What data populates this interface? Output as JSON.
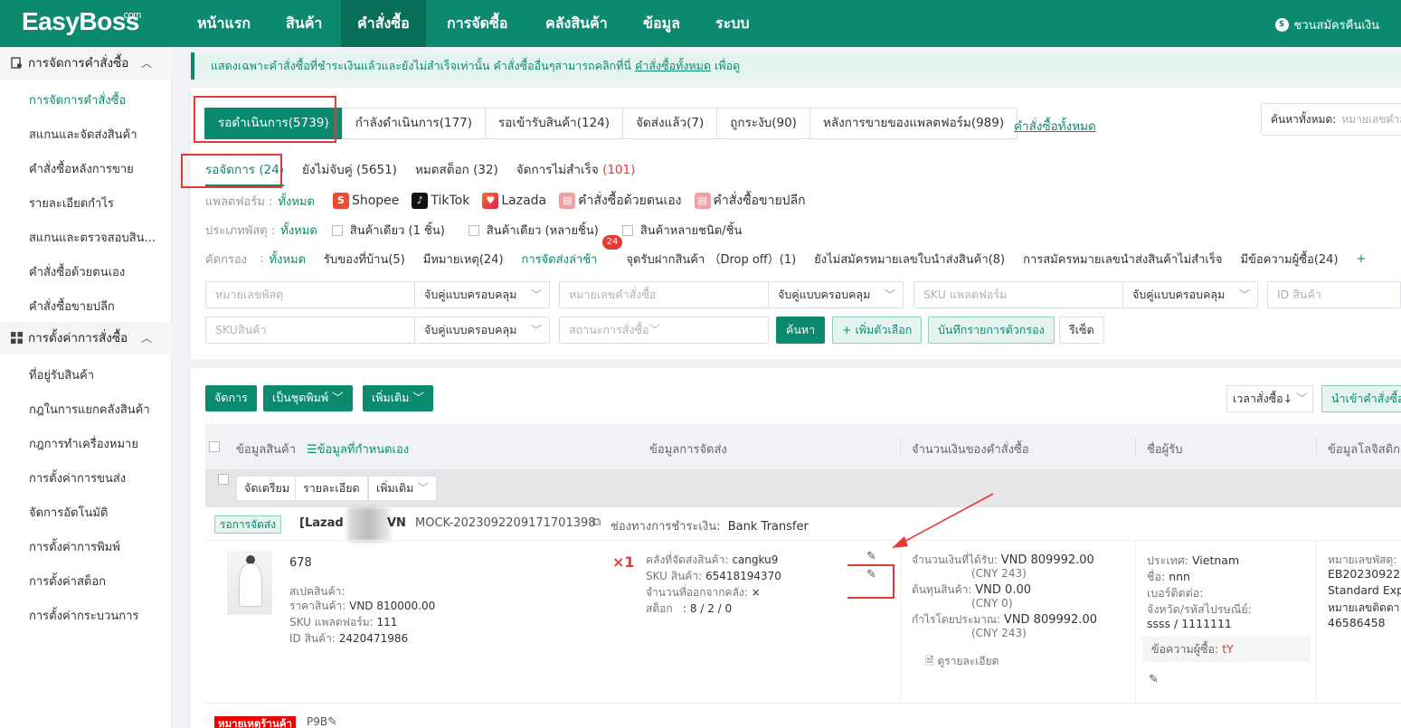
{
  "app": {
    "logo": "EasyBoss",
    "logo_sup": ".com"
  },
  "topnav": {
    "items": [
      "หน้าแรก",
      "สินค้า",
      "คำสั่งซื้อ",
      "การจัดซื้อ",
      "คลังสินค้า",
      "ข้อมูล",
      "ระบบ"
    ],
    "active_index": 2,
    "right_text": "ชวนสมัครคืนเงิน"
  },
  "sidebar": {
    "group1": "การจัดการคำสั่งซื้อ",
    "group1_items": [
      "การจัดการคำสั่งซื้อ",
      "สแกนและจัดส่งสินค้า",
      "คำสั่งซื้อหลังการขาย",
      "รายละเอียดกำไร",
      "สแกนและตรวจสอบสิน...",
      "คำสั่งซื้อด้วยตนเอง",
      "คำสั่งซื้อขายปลีก"
    ],
    "group2": "การตั้งค่าการสั่งซื้อ",
    "group2_items": [
      "ที่อยู่รับสินค้า",
      "กฎในการแยกคลังสินค้า",
      "กฎการทำเครื่องหมาย",
      "การตั้งค่าการขนส่ง",
      "จัดการอัตโนมัติ",
      "การตั้งค่าการพิมพ์",
      "การตั้งค่าสต็อก",
      "การตั้งค่ากระบวนการ"
    ]
  },
  "notice": {
    "text": "แสดงเฉพาะคำสั่งซื้อที่ชำระเงินแล้วและยังไม่สำเร็จเท่านั้น คำสั่งซื้ออื่นๆสามารถคลิกที่นี่",
    "link": "คำสั่งซื้อทั้งหมด",
    "suffix": "เพื่อดู"
  },
  "tabs": {
    "items": [
      "รอดำเนินการ(5739)",
      "กำลังดำเนินการ(177)",
      "รอเข้ารับสินค้า(124)",
      "จัดส่งแล้ว(7)",
      "ถูกระงับ(90)",
      "หลังการขายของแพลตฟอร์ม(989)"
    ],
    "all_link": "คำสั่งซื้อทั้งหมด"
  },
  "search": {
    "label": "ค้นหาทั้งหมด:",
    "placeholder": "หมายเลขคำสั่งซื้อ"
  },
  "subtabs": {
    "pending": "รอจัดการ (24)",
    "unpaired": "ยังไม่จับคู่ (5651)",
    "out_of_stock": "หมดสต็อก (32)",
    "failed_label": "จัดการไม่สำเร็จ",
    "failed_count": "(101)"
  },
  "filters": {
    "platform_label": "แพลตฟอร์ม :",
    "all": "ทั้งหมด",
    "platforms": [
      "Shopee",
      "TikTok",
      "Lazada",
      "คำสั่งซื้อด้วยตนเอง",
      "คำสั่งซื้อขายปลีก"
    ],
    "parcel_label": "ประเภทพัสดุ :",
    "parcel_types": [
      "สินค้าเดียว (1 ชิ้น)",
      "สินค้าเดียว (หลายชิ้น)",
      "สินค้าหลายชนิด/ชิ้น"
    ],
    "screen_label": "คัดกรอง",
    "screen_sep": ":",
    "screen_items": [
      "รับของที่บ้าน(5)",
      "มีหมายเหตุ(24)",
      "การจัดส่งล่าช้า",
      "จุดรับฝากสินค้า （Drop off）(1)",
      "ยังไม่สมัครหมายเลขใบนำส่งสินค้า(8)",
      "การสมัครหมายเลขนำส่งสินค้าไม่สำเร็จ",
      "มีข้อความผู้ซื้อ(24)"
    ],
    "late_badge": "24",
    "more": "+"
  },
  "inputs": {
    "parcel_no": "หมายเลขพัสดุ",
    "match_mode": "จับคู่แบบครอบคลุม",
    "order_no": "หมายเลขคำสั่งซื้อ",
    "platform_sku": "SKU แพลตฟอร์ม",
    "product_id": "ID สินค้า",
    "product_sku": "SKUสินค้า",
    "order_status": "สถานะการสั่งซื้อ"
  },
  "buttons": {
    "search": "ค้นหา",
    "add_option": "+ เพิ่มตัวเลือก",
    "save_filter": "บันทึกรายการตัวกรอง",
    "reset": "รีเซ็ต",
    "process": "จัดการ",
    "batch_print": "เป็นชุดพิมพ์",
    "more": "เพิ่มเติม",
    "sort": "เวลาสั่งซื้อ↓",
    "import": "นำเข้าคำสั่งซื้อ"
  },
  "table": {
    "headers": [
      "ข้อมูลสินค้า",
      "ข้อมูลที่กำหนดเอง",
      "ข้อมูลการจัดส่ง",
      "จำนวนเงินของคำสั่งซื้อ",
      "ชื่อผู้รับ",
      "ข้อมูลโลจิสติก"
    ],
    "row_actions": [
      "จัดเตรียม",
      "รายละเอียด",
      "เพิ่มเติม"
    ]
  },
  "order": {
    "status": "รอการจัดส่ง",
    "shop": "[Lazad",
    "region": "VN",
    "order_no": "MOCK-20230922091717013​98",
    "payment_label": "ช่องทางการชำระเงิน:",
    "payment": "Bank Transfer",
    "product_name": "678",
    "spec_label": "สเปคสินค้า:",
    "price_label": "ราคาสินค้า:",
    "price": "VND 810000.00",
    "platform_sku_label": "SKU แพลตฟอร์ม:",
    "platform_sku": "111",
    "product_id_label": "ID สินค้า:",
    "product_id": "2420471986",
    "qty": "×1",
    "warehouse_label": "คลังที่จัดส่งสินค้า:",
    "warehouse": "cangku9",
    "sku_label": "SKU สินค้า:",
    "sku": "65418194370",
    "out_label": "จำนวนที่ออกจากคลัง:",
    "out_value": "×",
    "stock_label": "สต็อก",
    "stock": ": 8 / 2 / 0",
    "received_label": "จำนวนเงินที่ได้รับ:",
    "received": "VND 809992.00",
    "received_cny": "(CNY 243)",
    "cost_label": "ต้นทุนสินค้า:",
    "cost": "VND 0.00",
    "cost_cny": "(CNY 0)",
    "profit_label": "กำไรโดยประมาณ:",
    "profit": "VND 809992.00",
    "profit_cny": "(CNY 243)",
    "view_details": "ดูรายละเอียด",
    "country_label": "ประเทศ:",
    "country": "Vietnam",
    "name_label": "ชื่อ:",
    "name": "nnn",
    "phone_label": "เบอร์ติดต่อ:",
    "province_label": "จังหวัด/รหัสไปรษณีย์:",
    "province": "ssss / 1111111",
    "buyer_msg_label": "ข้อความผู้ซื้อ:",
    "buyer_msg": "tY",
    "tracking_label": "หมายเลขพัสดุ:",
    "tracking": "EB20230922",
    "carrier": "Standard Exp",
    "contact_label": "หมายเลขติดตา",
    "contact": "46586458",
    "note_tag": "หมายเหตุร้านค้า",
    "note": "P9B"
  },
  "colors": {
    "brand": "#0c8a70",
    "danger": "#e53935"
  }
}
